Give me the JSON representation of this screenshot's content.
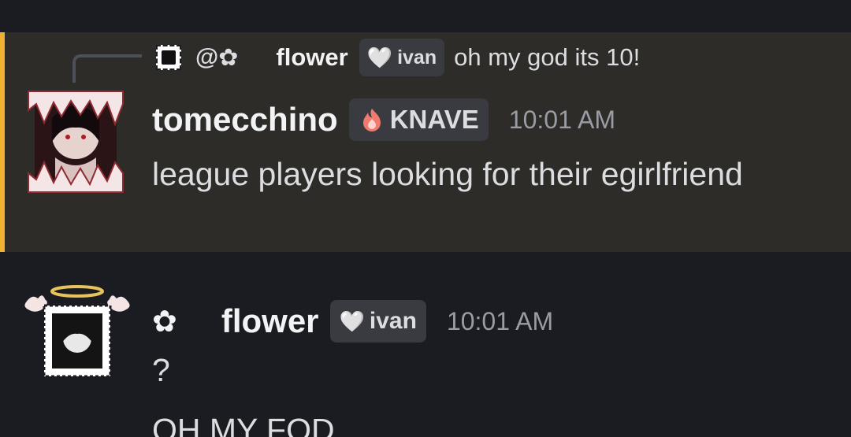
{
  "reply": {
    "avatar_icon": "pixel-portrait-stamp-icon",
    "at_symbol": "@",
    "flower_glyph": "✿",
    "name": "flower",
    "tag_heart": "🤍",
    "tag_label": "ivan",
    "text": "oh my god its 10!"
  },
  "message1": {
    "author": "tomecchino",
    "tag_icon": "flame-icon",
    "tag_label": "KNAVE",
    "timestamp": "10:01 AM",
    "text": "league players looking for their egirlfriend"
  },
  "message2": {
    "prefix": "✿",
    "author": "flower",
    "tag_heart": "🤍",
    "tag_label": "ivan",
    "timestamp": "10:01 AM",
    "line1": "?",
    "line2": "OH MY FOD"
  },
  "colors": {
    "background": "#1b1c21",
    "highlight_background": "#2e2c28",
    "highlight_bar": "#f0b132",
    "tag_background": "#3a3b41",
    "timestamp": "#9a9ca3"
  }
}
